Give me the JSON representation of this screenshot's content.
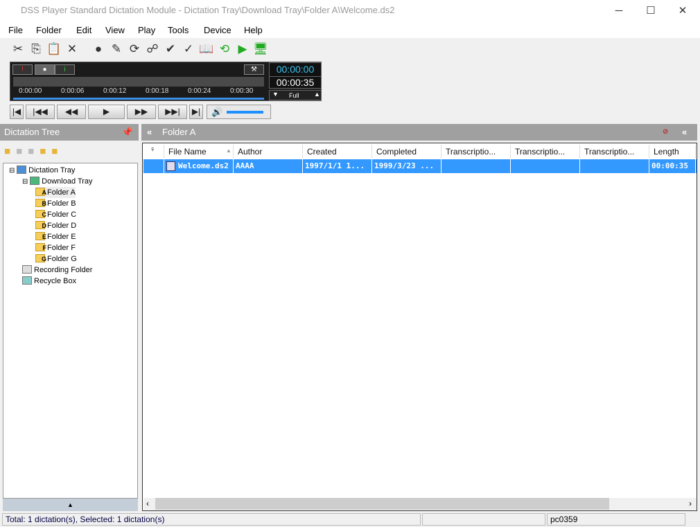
{
  "window": {
    "title": "DSS Player Standard Dictation Module - Dictation Tray\\Download Tray\\Folder A\\Welcome.ds2",
    "minimize": "─",
    "maximize": "☐",
    "close": "✕"
  },
  "menu": [
    "File",
    "Folder",
    "Edit",
    "View",
    "Play",
    "Tools",
    "Device",
    "Help"
  ],
  "toolbar": [
    {
      "icon": "cut-icon",
      "g": "✂"
    },
    {
      "icon": "copy-icon",
      "g": "⎘"
    },
    {
      "icon": "paste-icon",
      "g": "📋"
    },
    {
      "icon": "delete-icon",
      "g": "✕"
    },
    {
      "icon": "record-icon",
      "g": "●"
    },
    {
      "icon": "edit-icon",
      "g": "✎"
    },
    {
      "icon": "convert-icon",
      "g": "⟳"
    },
    {
      "icon": "send-icon",
      "g": "☍"
    },
    {
      "icon": "finish-icon",
      "g": "✔"
    },
    {
      "icon": "verify-icon",
      "g": "✓"
    },
    {
      "icon": "book-icon",
      "g": "📖"
    },
    {
      "icon": "refresh-icon",
      "g": "⟲"
    },
    {
      "icon": "transfer-icon",
      "g": "▶"
    },
    {
      "icon": "device-icon",
      "g": "🖥"
    }
  ],
  "player": {
    "ticks": [
      "0:00:00",
      "0:00:06",
      "0:00:12",
      "0:00:18",
      "0:00:24",
      "0:00:30"
    ],
    "current_time": "00:00:00",
    "total_time": "00:00:35",
    "zoom": "Full",
    "volume_percent": 95
  },
  "transport": [
    "|◀",
    "|◀◀",
    "◀◀",
    "▶",
    "▶▶",
    "▶▶|",
    "▶|"
  ],
  "tree": {
    "title": "Dictation Tree",
    "items": [
      {
        "label": "Dictation Tray",
        "level": 0
      },
      {
        "label": "Download Tray",
        "level": 1
      },
      {
        "label": "Folder A",
        "level": 2,
        "letter": "A",
        "selected": true
      },
      {
        "label": "Folder B",
        "level": 2,
        "letter": "B"
      },
      {
        "label": "Folder C",
        "level": 2,
        "letter": "C"
      },
      {
        "label": "Folder D",
        "level": 2,
        "letter": "D"
      },
      {
        "label": "Folder E",
        "level": 2,
        "letter": "E"
      },
      {
        "label": "Folder F",
        "level": 2,
        "letter": "F"
      },
      {
        "label": "Folder G",
        "level": 2,
        "letter": "G"
      },
      {
        "label": "Recording Folder",
        "level": 1
      },
      {
        "label": "Recycle Box",
        "level": 1
      }
    ]
  },
  "list": {
    "title": "Folder A",
    "columns": [
      "",
      "File Name",
      "Author",
      "Created",
      "Completed",
      "Transcriptio...",
      "Transcriptio...",
      "Transcriptio...",
      "Length"
    ],
    "rows": [
      [
        "",
        "Welcome.ds2",
        "AAAA",
        "1997/1/1 1...",
        "1999/3/23 ...",
        "",
        "",
        "",
        "00:00:35"
      ]
    ],
    "selected_color": "#3399ff"
  },
  "status": {
    "total": "Total: 1 dictation(s), Selected: 1 dictation(s)",
    "middle": "",
    "user": "pc0359"
  }
}
